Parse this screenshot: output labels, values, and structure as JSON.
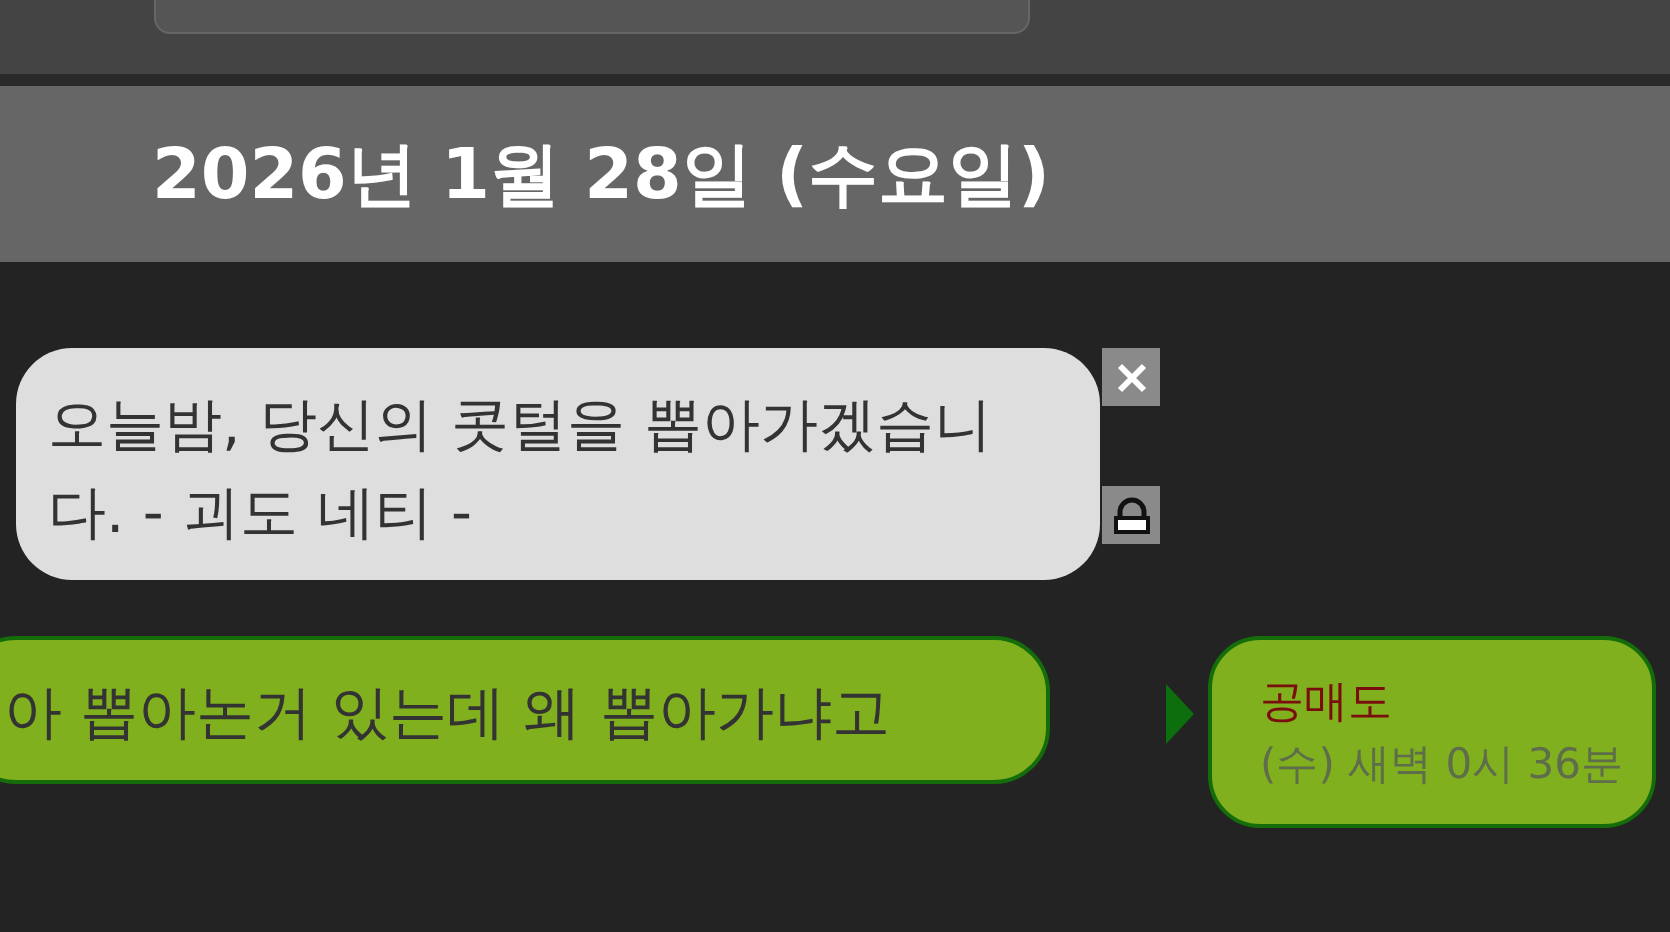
{
  "date_header": "2026년 1월 28일 (수요일)",
  "messages": [
    {
      "kind": "incoming",
      "text": "오늘밤, 당신의 콧털을 뽑아가겠습니다. - 괴도 네티 -",
      "locked": true
    },
    {
      "kind": "outgoing",
      "text": "아 뽑아논거 있는데 왜 뽑아가냐고",
      "sender": "공매도",
      "time": "(수) 새벽 0시 36분"
    }
  ]
}
